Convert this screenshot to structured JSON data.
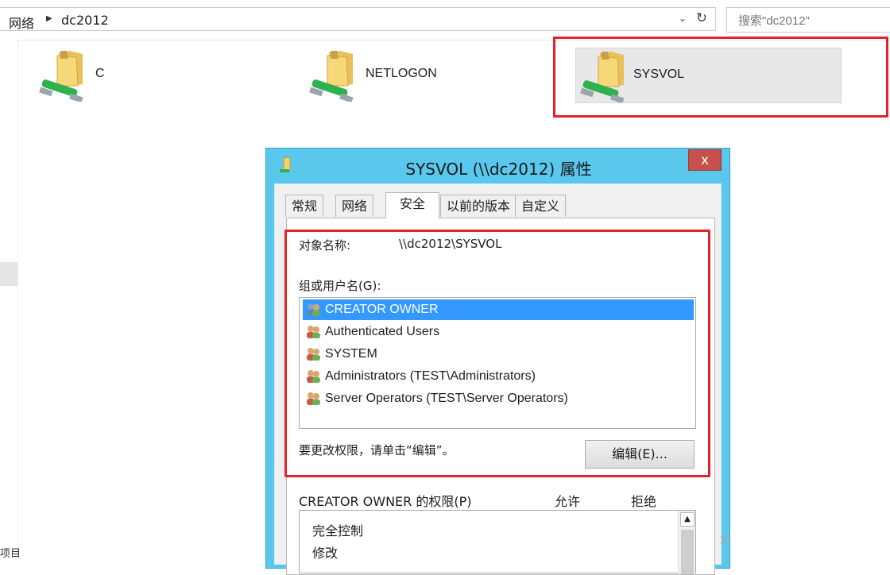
{
  "address_bar": {
    "crumbs": [
      "网络",
      "dc2012"
    ],
    "search_placeholder": "搜索\"dc2012\""
  },
  "left_pane": {
    "partial_text": "项目"
  },
  "shares": [
    {
      "name": "C",
      "icon": "shared-folder-icon"
    },
    {
      "name": "NETLOGON",
      "icon": "shared-folder-icon"
    },
    {
      "name": "SYSVOL",
      "icon": "shared-folder-icon",
      "selected": true
    }
  ],
  "dialog": {
    "title": "SYSVOL (\\\\dc2012) 属性",
    "close_label": "x",
    "tabs": [
      {
        "label": "常规"
      },
      {
        "label": "网络"
      },
      {
        "label": "安全",
        "active": true
      },
      {
        "label": "以前的版本"
      },
      {
        "label": "自定义"
      }
    ],
    "security": {
      "object_label": "对象名称:",
      "object_value": "\\\\dc2012\\SYSVOL",
      "groups_label": "组或用户名(G):",
      "users": [
        {
          "name": "CREATOR OWNER",
          "selected": true
        },
        {
          "name": "Authenticated Users"
        },
        {
          "name": "SYSTEM"
        },
        {
          "name": "Administrators (TEST\\Administrators)"
        },
        {
          "name": "Server Operators (TEST\\Server Operators)"
        }
      ],
      "edit_hint": "要更改权限，请单击“编辑”。",
      "edit_button": "编辑(E)...",
      "permissions_label": "CREATOR OWNER 的权限(P)",
      "allow_label": "允许",
      "deny_label": "拒绝",
      "permissions": [
        "完全控制",
        "修改"
      ]
    }
  },
  "watermark": "女",
  "colors": {
    "dialog_frame": "#5ac8ec",
    "highlight_red": "#e3232a",
    "selection_blue": "#3399ff",
    "close_red": "#c7504a"
  }
}
